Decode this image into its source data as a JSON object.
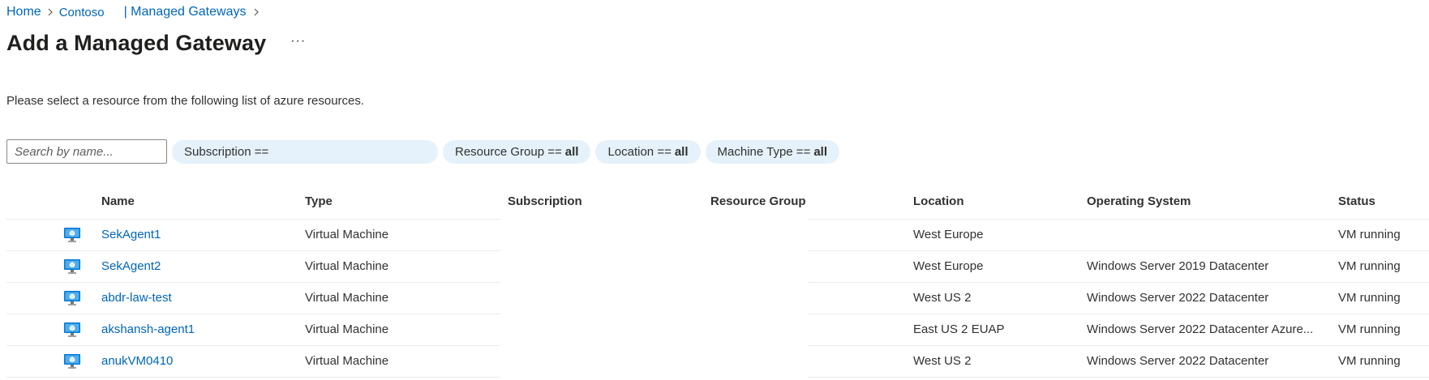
{
  "breadcrumb": {
    "home": "Home",
    "contoso": "Contoso",
    "current": "| Managed Gateways"
  },
  "title": "Add a Managed Gateway",
  "more_label": "···",
  "description": "Please select a resource from the following list of azure resources.",
  "search": {
    "placeholder": "Search by name..."
  },
  "filters": {
    "subscription": {
      "label": "Subscription ==",
      "value": ""
    },
    "resource_group": {
      "label": "Resource Group ==",
      "value": "all"
    },
    "location": {
      "label": "Location ==",
      "value": "all"
    },
    "machine_type": {
      "label": "Machine Type ==",
      "value": "all"
    }
  },
  "table": {
    "columns": {
      "name": "Name",
      "type": "Type",
      "subscription": "Subscription",
      "resource_group": "Resource Group",
      "location": "Location",
      "os": "Operating System",
      "status": "Status"
    },
    "rows": [
      {
        "icon": "virtual-machine-icon",
        "name": "SekAgent1",
        "type": "Virtual Machine",
        "subscription": "",
        "resource_group": "",
        "location": "West Europe",
        "os": "",
        "status": "VM running"
      },
      {
        "icon": "virtual-machine-icon",
        "name": "SekAgent2",
        "type": "Virtual Machine",
        "subscription": "",
        "resource_group": "",
        "location": "West Europe",
        "os": "Windows Server 2019 Datacenter",
        "status": "VM running"
      },
      {
        "icon": "virtual-machine-icon",
        "name": "abdr-law-test",
        "type": "Virtual Machine",
        "subscription": "",
        "resource_group": "",
        "location": "West US 2",
        "os": "Windows Server 2022 Datacenter",
        "status": "VM running"
      },
      {
        "icon": "virtual-machine-icon",
        "name": "akshansh-agent1",
        "type": "Virtual Machine",
        "subscription": "",
        "resource_group": "",
        "location": "East US 2 EUAP",
        "os": "Windows Server 2022 Datacenter Azure...",
        "status": "VM running"
      },
      {
        "icon": "virtual-machine-icon",
        "name": "anukVM0410",
        "type": "Virtual Machine",
        "subscription": "",
        "resource_group": "",
        "location": "West US 2",
        "os": "Windows Server 2022 Datacenter",
        "status": "VM running"
      }
    ]
  },
  "colors": {
    "link": "#0066b8",
    "pill_background": "#e5f1fb",
    "divider": "#edebe9",
    "vm_icon": "#0078d4"
  }
}
